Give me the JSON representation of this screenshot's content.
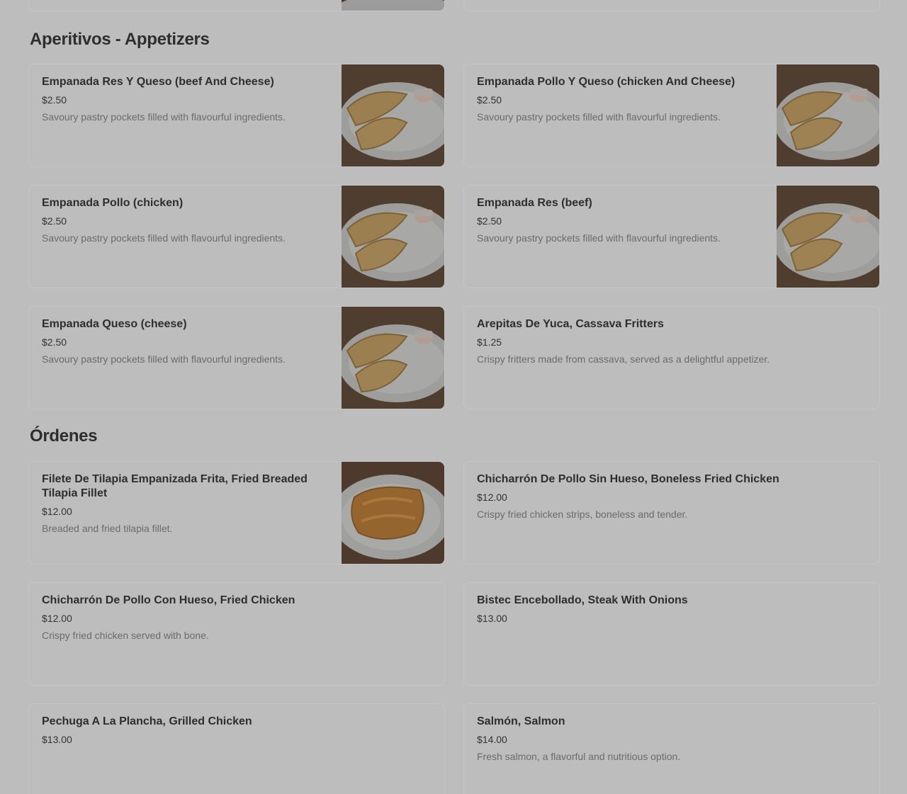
{
  "sections": [
    {
      "title": "Aperitivos - Appetizers",
      "items": [
        {
          "title": "Empanada Res Y Queso (beef And Cheese)",
          "price": "$2.50",
          "desc": "Savoury pastry pockets filled with flavourful ingredients.",
          "image": "empanadas"
        },
        {
          "title": "Empanada Pollo Y Queso (chicken And Cheese)",
          "price": "$2.50",
          "desc": "Savoury pastry pockets filled with flavourful ingredients.",
          "image": "empanadas"
        },
        {
          "title": "Empanada Pollo (chicken)",
          "price": "$2.50",
          "desc": "Savoury pastry pockets filled with flavourful ingredients.",
          "image": "empanadas"
        },
        {
          "title": "Empanada Res (beef)",
          "price": "$2.50",
          "desc": "Savoury pastry pockets filled with flavourful ingredients.",
          "image": "empanadas"
        },
        {
          "title": "Empanada Queso (cheese)",
          "price": "$2.50",
          "desc": "Savoury pastry pockets filled with flavourful ingredients.",
          "image": "empanadas"
        },
        {
          "title": "Arepitas De Yuca, Cassava Fritters",
          "price": "$1.25",
          "desc": "Crispy fritters made from cassava, served as a delightful appetizer.",
          "image": ""
        }
      ]
    },
    {
      "title": "Órdenes",
      "items": [
        {
          "title": "Filete De Tilapia Empanizada Frita, Fried Breaded Tilapia Fillet",
          "price": "$12.00",
          "desc": "Breaded and fried tilapia fillet.",
          "image": "tilapia"
        },
        {
          "title": "Chicharrón De Pollo Sin Hueso, Boneless Fried Chicken",
          "price": "$12.00",
          "desc": "Crispy fried chicken strips, boneless and tender.",
          "image": ""
        },
        {
          "title": "Chicharrón De Pollo Con Hueso, Fried Chicken",
          "price": "$12.00",
          "desc": "Crispy fried chicken served with bone.",
          "image": ""
        },
        {
          "title": "Bistec Encebollado, Steak With Onions",
          "price": "$13.00",
          "desc": "",
          "image": ""
        },
        {
          "title": "Pechuga A La Plancha, Grilled Chicken",
          "price": "$13.00",
          "desc": "",
          "image": ""
        },
        {
          "title": "Salmón, Salmon",
          "price": "$14.00",
          "desc": "Fresh salmon, a flavorful and nutritious option.",
          "image": ""
        }
      ]
    }
  ]
}
